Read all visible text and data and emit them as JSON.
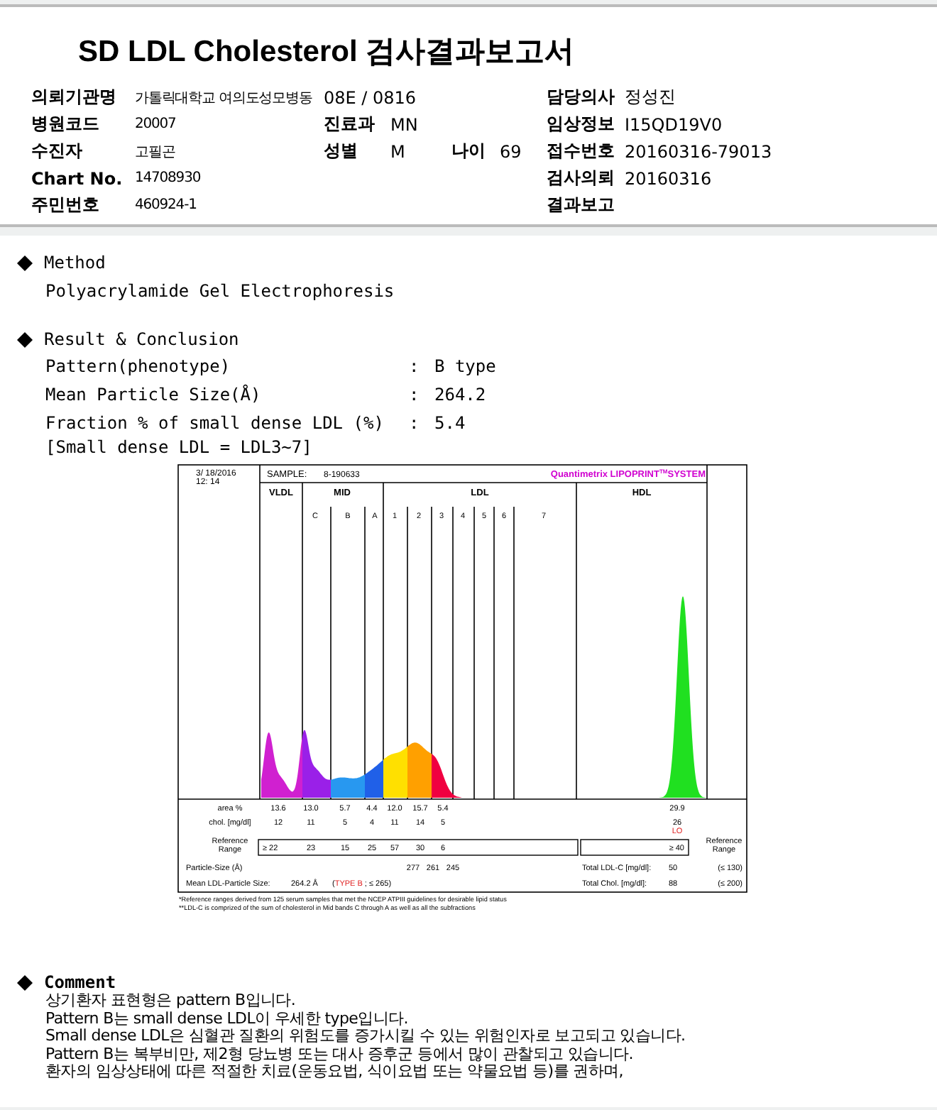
{
  "header": {
    "title": "SD LDL Cholesterol 검사결과보고서",
    "rows": [
      [
        [
          {
            "label": "의뢰기관명",
            "value": "가톨릭대학교 여의도성모병동"
          }
        ],
        [
          {
            "value": "08E / 0816"
          }
        ],
        [
          {
            "label": "담당의사",
            "value": "정성진"
          }
        ]
      ],
      [
        [
          {
            "label": "병원코드",
            "value": "20007"
          }
        ],
        [
          {
            "label": "진료과",
            "value": "MN"
          }
        ],
        [
          {
            "label": "임상정보",
            "value": "I15QD19V0"
          }
        ]
      ],
      [
        [
          {
            "label": "수진자",
            "value": "고필곤"
          }
        ],
        [
          {
            "label": "성별",
            "value": "M"
          },
          {
            "label": "나이",
            "value": "69"
          }
        ],
        [
          {
            "label": "접수번호",
            "value": "20160316-79013"
          }
        ]
      ],
      [
        [
          {
            "label": "Chart No.",
            "value": "14708930"
          }
        ],
        [],
        [
          {
            "label": "검사의뢰",
            "value": "20160316"
          }
        ]
      ],
      [
        [
          {
            "label": "주민번호",
            "value": "460924-1"
          }
        ],
        [],
        [
          {
            "label": "결과보고"
          }
        ]
      ]
    ]
  },
  "method": {
    "heading": "Method",
    "text": "Polyacrylamide Gel Electrophoresis"
  },
  "result": {
    "heading": "Result & Conclusion",
    "items": [
      {
        "label": "Pattern(phenotype)",
        "separator": ":",
        "value": "B type"
      },
      {
        "label": "Mean Particle Size(Å)",
        "separator": ":",
        "value": "264.2"
      },
      {
        "label": "Fraction % of small dense LDL (%)",
        "separator": ":",
        "value": "5.4"
      }
    ],
    "note": "[Small dense LDL = LDL3~7]"
  },
  "chart_image": {
    "date": "3/ 18/2016",
    "time": "12: 14",
    "sample_label": "SAMPLE:",
    "sample": "8-190633",
    "brand": {
      "name": "Quantimetrix LIPOPRINT",
      "mark": "TM",
      "suffix": "SYSTEM"
    },
    "groups": [
      "VLDL",
      "MID",
      "LDL",
      "HDL"
    ],
    "bands": [
      "C",
      "B",
      "A",
      "1",
      "2",
      "3",
      "4",
      "5",
      "6",
      "7"
    ],
    "rows": [
      {
        "label": "area %",
        "values": [
          "13.6",
          "13.0",
          "5.7",
          "4.4",
          "12.0",
          "15.7",
          "5.4"
        ],
        "hdl": "29.9"
      },
      {
        "label": "chol. [mg/dl]",
        "values": [
          "12",
          "11",
          "5",
          "4",
          "11",
          "14",
          "5"
        ],
        "hdl": "26",
        "flag": "LO"
      }
    ],
    "reference": {
      "label_lines": [
        "Reference",
        "Range"
      ],
      "side_label_lines": [
        "Reference",
        "Range"
      ],
      "values": [
        "≥ 22",
        "23",
        "15",
        "25",
        "57",
        "30",
        "6"
      ],
      "hdl": "≥ 40"
    },
    "particle_size": {
      "label": "Particle-Size (Å)",
      "values": [
        "277",
        "261",
        "245"
      ]
    },
    "mean": {
      "label": "Mean LDL-Particle Size:",
      "value": "264.2 Å",
      "open": "(",
      "type": "TYPE B",
      "close": " ; ≤ 265)"
    },
    "totals": [
      {
        "label": "Total LDL-C [mg/dl]:",
        "value": "50",
        "range": "(≤ 130)"
      },
      {
        "label": "Total Chol. [mg/dl]:",
        "value": "88",
        "range": "(≤ 200)"
      }
    ],
    "notes": [
      "*Reference ranges derived from 125 serum samples that met the NCEP ATPIII guidelines for desirable lipid status",
      "**LDL-C is comprized of the sum of cholesterol in Mid bands C through A as well as all the subfractions"
    ]
  },
  "comment": {
    "heading": "Comment",
    "lines": [
      "상기환자 표현형은 pattern B입니다.",
      "Pattern B는 small dense LDL이 우세한 type입니다.",
      "Small dense LDL은 심혈관 질환의 위험도를 증가시킬 수 있는 위험인자로 보고되고 있습니다.",
      "Pattern B는 복부비만, 제2형 당뇨병 또는 대사 증후군 등에서 많이 관찰되고 있습니다.",
      "환자의 임상상태에 따른 적절한 치료(운동요법, 식이요법 또는 약물요법 등)를 권하며,"
    ]
  }
}
